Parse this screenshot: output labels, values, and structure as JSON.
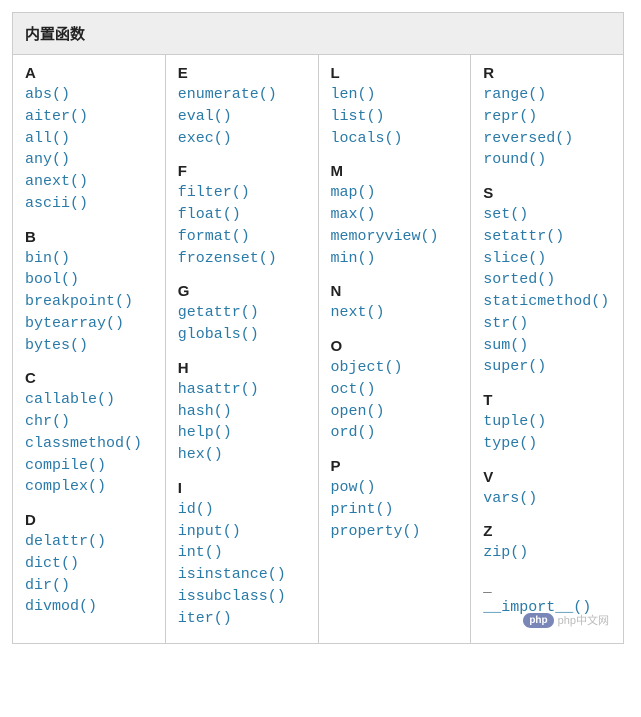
{
  "title": "内置函数",
  "watermark": "php中文网",
  "columns": [
    [
      {
        "letter": "A",
        "fns": [
          "abs()",
          "aiter()",
          "all()",
          "any()",
          "anext()",
          "ascii()"
        ]
      },
      {
        "letter": "B",
        "fns": [
          "bin()",
          "bool()",
          "breakpoint()",
          "bytearray()",
          "bytes()"
        ]
      },
      {
        "letter": "C",
        "fns": [
          "callable()",
          "chr()",
          "classmethod()",
          "compile()",
          "complex()"
        ]
      },
      {
        "letter": "D",
        "fns": [
          "delattr()",
          "dict()",
          "dir()",
          "divmod()"
        ]
      }
    ],
    [
      {
        "letter": "E",
        "fns": [
          "enumerate()",
          "eval()",
          "exec()"
        ]
      },
      {
        "letter": "F",
        "fns": [
          "filter()",
          "float()",
          "format()",
          "frozenset()"
        ]
      },
      {
        "letter": "G",
        "fns": [
          "getattr()",
          "globals()"
        ]
      },
      {
        "letter": "H",
        "fns": [
          "hasattr()",
          "hash()",
          "help()",
          "hex()"
        ]
      },
      {
        "letter": "I",
        "fns": [
          "id()",
          "input()",
          "int()",
          "isinstance()",
          "issubclass()",
          "iter()"
        ]
      }
    ],
    [
      {
        "letter": "L",
        "fns": [
          "len()",
          "list()",
          "locals()"
        ]
      },
      {
        "letter": "M",
        "fns": [
          "map()",
          "max()",
          "memoryview()",
          "min()"
        ]
      },
      {
        "letter": "N",
        "fns": [
          "next()"
        ]
      },
      {
        "letter": "O",
        "fns": [
          "object()",
          "oct()",
          "open()",
          "ord()"
        ]
      },
      {
        "letter": "P",
        "fns": [
          "pow()",
          "print()",
          "property()"
        ]
      }
    ],
    [
      {
        "letter": "R",
        "fns": [
          "range()",
          "repr()",
          "reversed()",
          "round()"
        ]
      },
      {
        "letter": "S",
        "fns": [
          "set()",
          "setattr()",
          "slice()",
          "sorted()",
          "staticmethod()",
          "str()",
          "sum()",
          "super()"
        ]
      },
      {
        "letter": "T",
        "fns": [
          "tuple()",
          "type()"
        ]
      },
      {
        "letter": "V",
        "fns": [
          "vars()"
        ]
      },
      {
        "letter": "Z",
        "fns": [
          "zip()"
        ]
      },
      {
        "letter": "_",
        "fns": [
          "__import__()"
        ]
      }
    ]
  ]
}
